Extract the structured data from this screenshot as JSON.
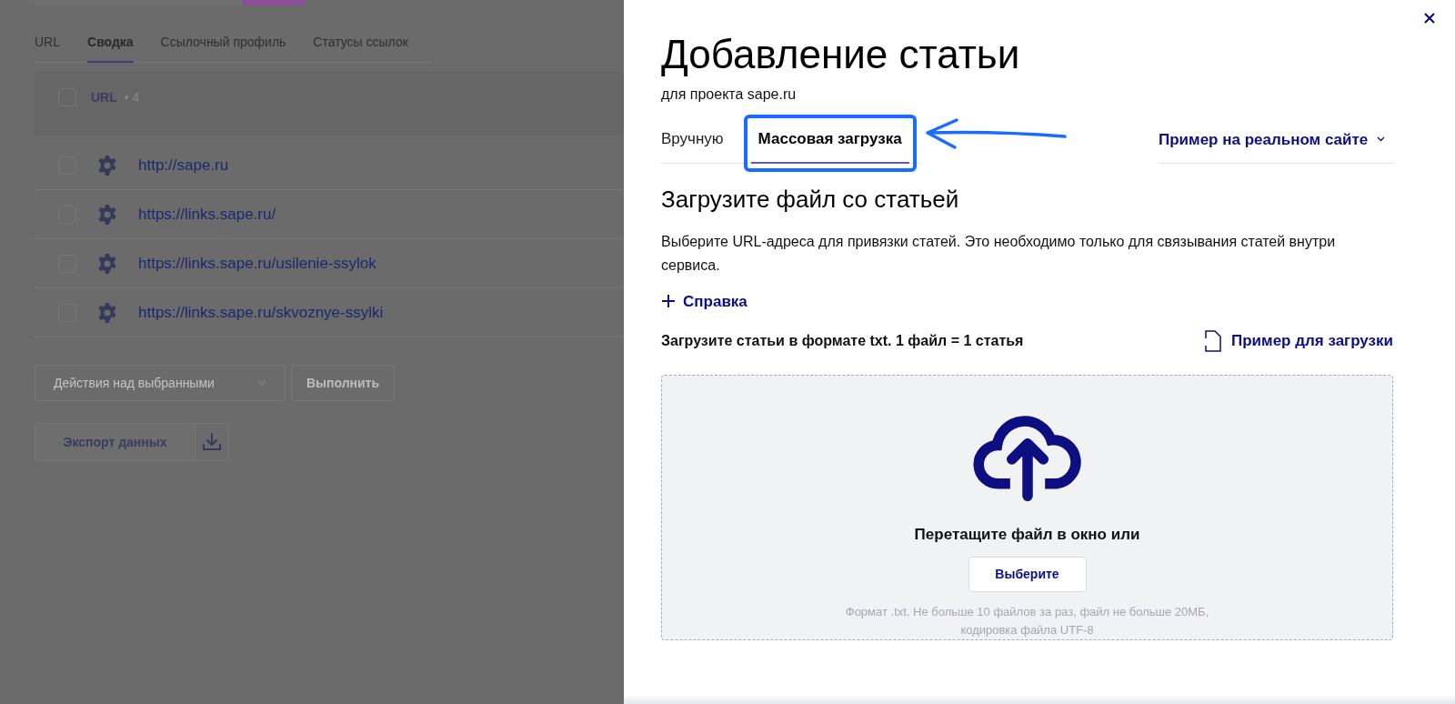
{
  "background_page": {
    "tabs": [
      {
        "label": "URL",
        "selected": false
      },
      {
        "label": "Сводка",
        "selected": true
      },
      {
        "label": "Ссылочный профиль",
        "selected": false
      },
      {
        "label": "Статусы ссылок",
        "selected": false
      }
    ],
    "table": {
      "header_checked": false,
      "header": "URL",
      "count": "• 4",
      "rows": [
        {
          "url": "http://sape.ru",
          "checked": false
        },
        {
          "url": "https://links.sape.ru/",
          "checked": false
        },
        {
          "url": "https://links.sape.ru/usilenie-ssylok",
          "checked": false
        },
        {
          "url": "https://links.sape.ru/skvoznye-ssylki",
          "checked": false
        }
      ]
    },
    "actions_select": "Действия над выбранными",
    "run_button": "Выполнить",
    "export_button": "Экспорт данных"
  },
  "dialog": {
    "title": "Добавление статьи",
    "subtitle": "для проекта sape.ru",
    "tabs": [
      {
        "label": "Вручную",
        "selected": false
      },
      {
        "label": "Массовая загрузка",
        "selected": true
      }
    ],
    "example_link": "Пример на реальном сайте",
    "heading": "Загрузите файл со статьей",
    "description": "Выберите URL-адреса для привязки статей. Это необходимо только для связывания статей внутри сервиса.",
    "help_link": "Справка",
    "upload_label": "Загрузите статьи в формате txt. 1 файл = 1 статья",
    "sample_link": "Пример для загрузки",
    "dropzone": {
      "prompt": "Перетащите файл в окно или",
      "button": "Выберите",
      "hint": "Формат .txt. Не больше 10 файлов за раз, файл не больше 20МБ, кодировка файла UTF-8"
    }
  }
}
